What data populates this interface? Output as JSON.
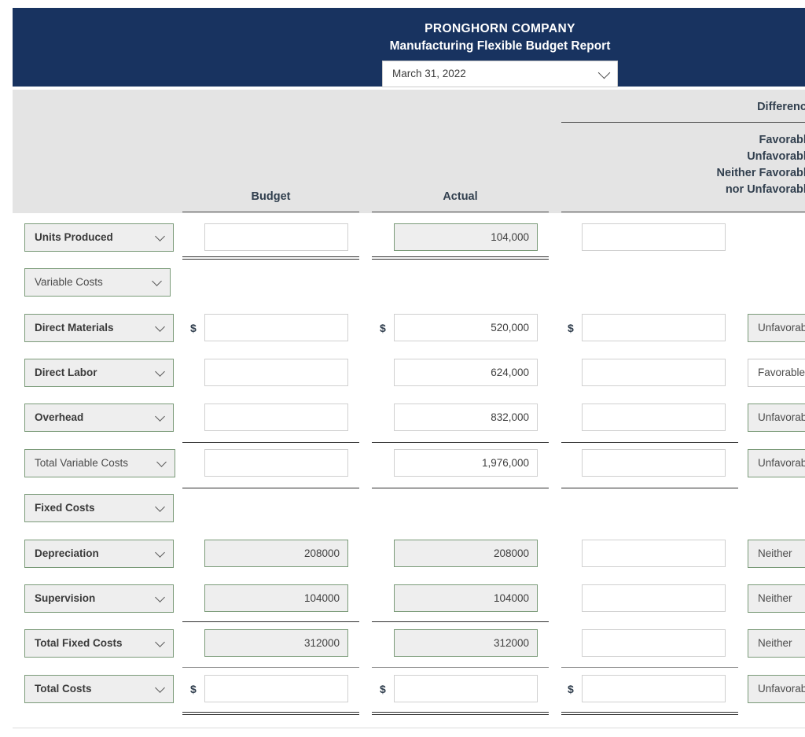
{
  "header": {
    "company": "PRONGHORN COMPANY",
    "report_title": "Manufacturing Flexible Budget Report",
    "period_value": "March 31, 2022",
    "period_caret_icon": "chevron-down-icon"
  },
  "columns": {
    "budget": "Budget",
    "actual": "Actual",
    "difference": "Difference",
    "difference_note_line1": "Favorable",
    "difference_note_line2": "Unfavorable",
    "difference_note_line3": "Neither Favorable",
    "difference_note_line4": "nor Unfavorable"
  },
  "currency_symbol": "$",
  "rows": [
    {
      "label": "Units Produced",
      "label_bold": true,
      "budget": "",
      "budget_filled": false,
      "actual": "104,000",
      "actual_filled": true,
      "difference": "",
      "difference_filled": false,
      "status": "",
      "status_filled": false,
      "show_dollar": false
    },
    {
      "label": "Variable Costs",
      "label_bold": false,
      "budget": null,
      "actual": null,
      "difference": null,
      "status": "",
      "show_dollar": false
    },
    {
      "label": "Direct Materials",
      "label_bold": true,
      "budget": "",
      "budget_filled": false,
      "actual": "520,000",
      "actual_filled": false,
      "difference": "",
      "difference_filled": false,
      "status": "Unfavorable",
      "status_filled": true,
      "show_dollar": true
    },
    {
      "label": "Direct Labor",
      "label_bold": true,
      "budget": "",
      "budget_filled": false,
      "actual": "624,000",
      "actual_filled": false,
      "difference": "",
      "difference_filled": false,
      "status": "Favorable",
      "status_filled": false,
      "show_dollar": false
    },
    {
      "label": "Overhead",
      "label_bold": true,
      "budget": "",
      "budget_filled": false,
      "actual": "832,000",
      "actual_filled": false,
      "difference": "",
      "difference_filled": false,
      "status": "Unfavorable",
      "status_filled": true,
      "show_dollar": false
    },
    {
      "label": "Total Variable Costs",
      "label_bold": false,
      "budget": "",
      "budget_filled": false,
      "actual": "1,976,000",
      "actual_filled": false,
      "difference": "",
      "difference_filled": false,
      "status": "Unfavorable",
      "status_filled": true,
      "show_dollar": false
    },
    {
      "label": "Fixed Costs",
      "label_bold": true,
      "budget": null,
      "actual": null,
      "difference": null,
      "status": "",
      "show_dollar": false
    },
    {
      "label": "Depreciation",
      "label_bold": true,
      "budget": "208000",
      "budget_filled": true,
      "actual": "208000",
      "actual_filled": true,
      "difference": "",
      "difference_filled": false,
      "status": "Neither",
      "status_filled": true,
      "show_dollar": false
    },
    {
      "label": "Supervision",
      "label_bold": true,
      "budget": "104000",
      "budget_filled": true,
      "actual": "104000",
      "actual_filled": true,
      "difference": "",
      "difference_filled": false,
      "status": "Neither",
      "status_filled": true,
      "show_dollar": false
    },
    {
      "label": "Total Fixed Costs",
      "label_bold": true,
      "budget": "312000",
      "budget_filled": true,
      "actual": "312000",
      "actual_filled": true,
      "difference": "",
      "difference_filled": false,
      "status": "Neither",
      "status_filled": true,
      "show_dollar": false
    },
    {
      "label": "Total Costs",
      "label_bold": true,
      "budget": "",
      "budget_filled": false,
      "actual": "",
      "actual_filled": false,
      "difference": "",
      "difference_filled": false,
      "status": "Unfavorable",
      "status_filled": true,
      "show_dollar": true
    }
  ],
  "colors": {
    "header_navy": "#183360",
    "band_gray": "#e4e4e4",
    "filled_border_green": "#7a9a78",
    "filled_bg": "#eeeeee"
  }
}
